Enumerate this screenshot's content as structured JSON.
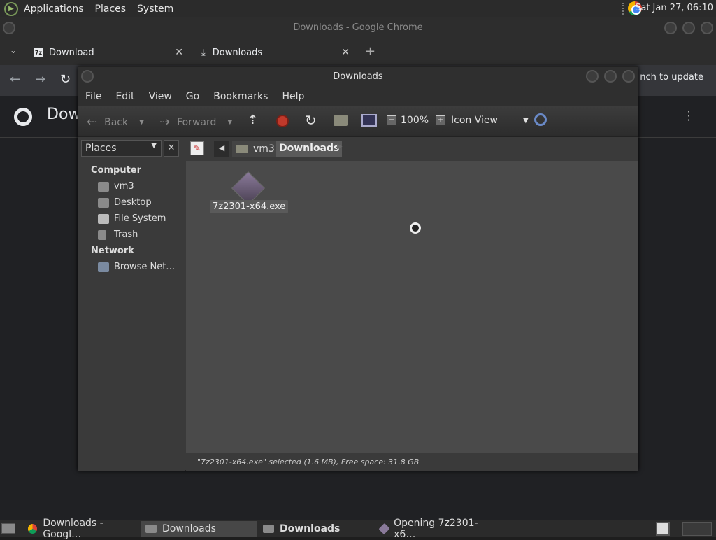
{
  "topbar": {
    "menus": [
      "Applications",
      "Places",
      "System"
    ],
    "clock": "Sat Jan 27, 06:10"
  },
  "chrome": {
    "window_title": "Downloads - Google Chrome",
    "tabs": [
      {
        "label": "Download",
        "fav": "7z"
      },
      {
        "label": "Downloads"
      }
    ],
    "new_tab": "+",
    "update_text": "nch to update",
    "page_heading": "Dow"
  },
  "nautilus": {
    "title": "Downloads",
    "menu": [
      "File",
      "Edit",
      "View",
      "Go",
      "Bookmarks",
      "Help"
    ],
    "toolbar": {
      "back": "Back",
      "forward": "Forward",
      "zoom": "100%",
      "view_mode": "Icon View"
    },
    "sidebar": {
      "selector": "Places",
      "sections": [
        {
          "header": "Computer",
          "items": [
            "vm3",
            "Desktop",
            "File System",
            "Trash"
          ]
        },
        {
          "header": "Network",
          "items": [
            "Browse Net…"
          ]
        }
      ]
    },
    "path": [
      "vm3",
      "Downloads"
    ],
    "files": [
      {
        "name": "7z2301-x64.exe"
      }
    ],
    "status": "\"7z2301-x64.exe\" selected (1.6 MB), Free space: 31.8 GB"
  },
  "taskbar": {
    "items": [
      "Downloads - Googl…",
      "Downloads",
      "Downloads",
      "Opening 7z2301-x6…"
    ]
  }
}
